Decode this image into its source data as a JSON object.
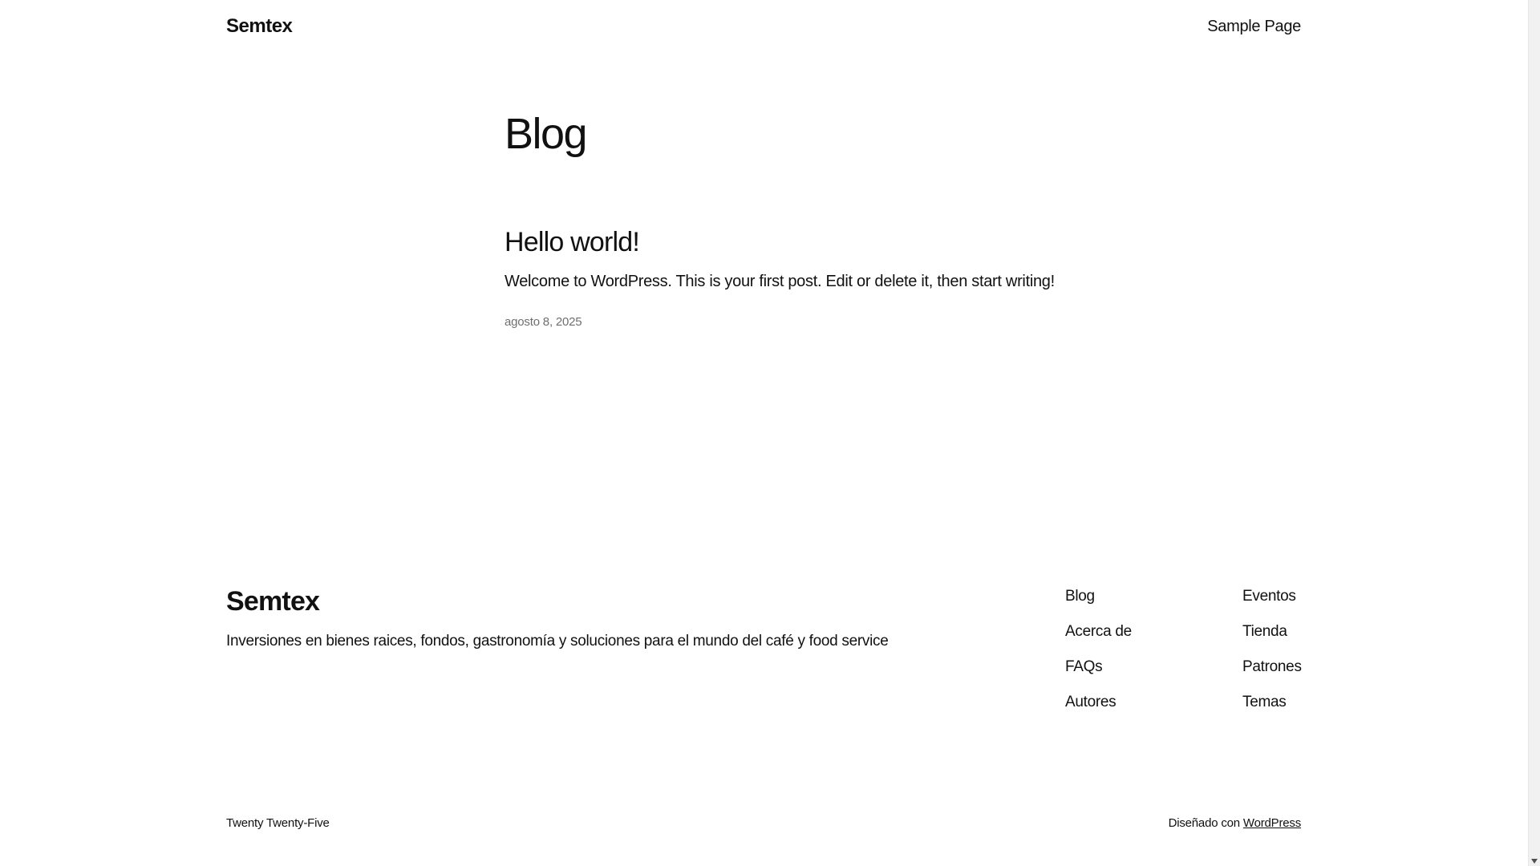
{
  "header": {
    "site_title": "Semtex",
    "nav": [
      "Sample Page"
    ]
  },
  "main": {
    "page_heading": "Blog",
    "post": {
      "title": "Hello world!",
      "excerpt": "Welcome to WordPress. This is your first post. Edit or delete it, then start writing!",
      "date": "agosto 8, 2025"
    }
  },
  "footer": {
    "site_title": "Semtex",
    "tagline": "Inversiones en bienes raices, fondos, gastronomía y soluciones para el mundo del café y food service",
    "nav_col1": [
      "Blog",
      "Acerca de",
      "FAQs",
      "Autores"
    ],
    "nav_col2": [
      "Eventos",
      "Tienda",
      "Patrones",
      "Temas"
    ],
    "credit_left": "Twenty Twenty-Five",
    "credit_right_prefix": "Diseñado con",
    "credit_right_link": "WordPress"
  }
}
